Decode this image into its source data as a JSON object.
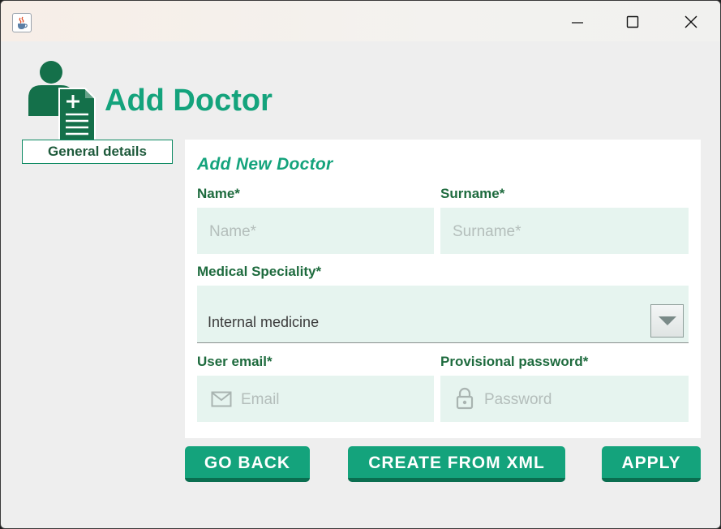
{
  "window": {
    "icon": "java-cup-icon",
    "controls": [
      "minimize-icon",
      "maximize-icon",
      "close-icon"
    ]
  },
  "header": {
    "icon": "doctor-clipboard-icon",
    "title": "Add Doctor"
  },
  "tabs": [
    {
      "label": "General details"
    }
  ],
  "form": {
    "title": "Add New Doctor",
    "name": {
      "label": "Name*",
      "placeholder": "Name*"
    },
    "surname": {
      "label": "Surname*",
      "placeholder": "Surname*"
    },
    "speciality": {
      "label": "Medical Speciality*",
      "value": "Internal medicine"
    },
    "email": {
      "label": "User email*",
      "placeholder": "Email",
      "icon": "mail-icon"
    },
    "password": {
      "label": "Provisional password*",
      "placeholder": "Password",
      "icon": "lock-icon"
    }
  },
  "buttons": {
    "back": "GO BACK",
    "xml": "CREATE FROM XML",
    "apply": "APPLY"
  },
  "colors": {
    "accent": "#14a37c",
    "accent_dark": "#0a6e50",
    "label_green": "#1e6b3e",
    "field_bg": "#e6f4ef"
  }
}
